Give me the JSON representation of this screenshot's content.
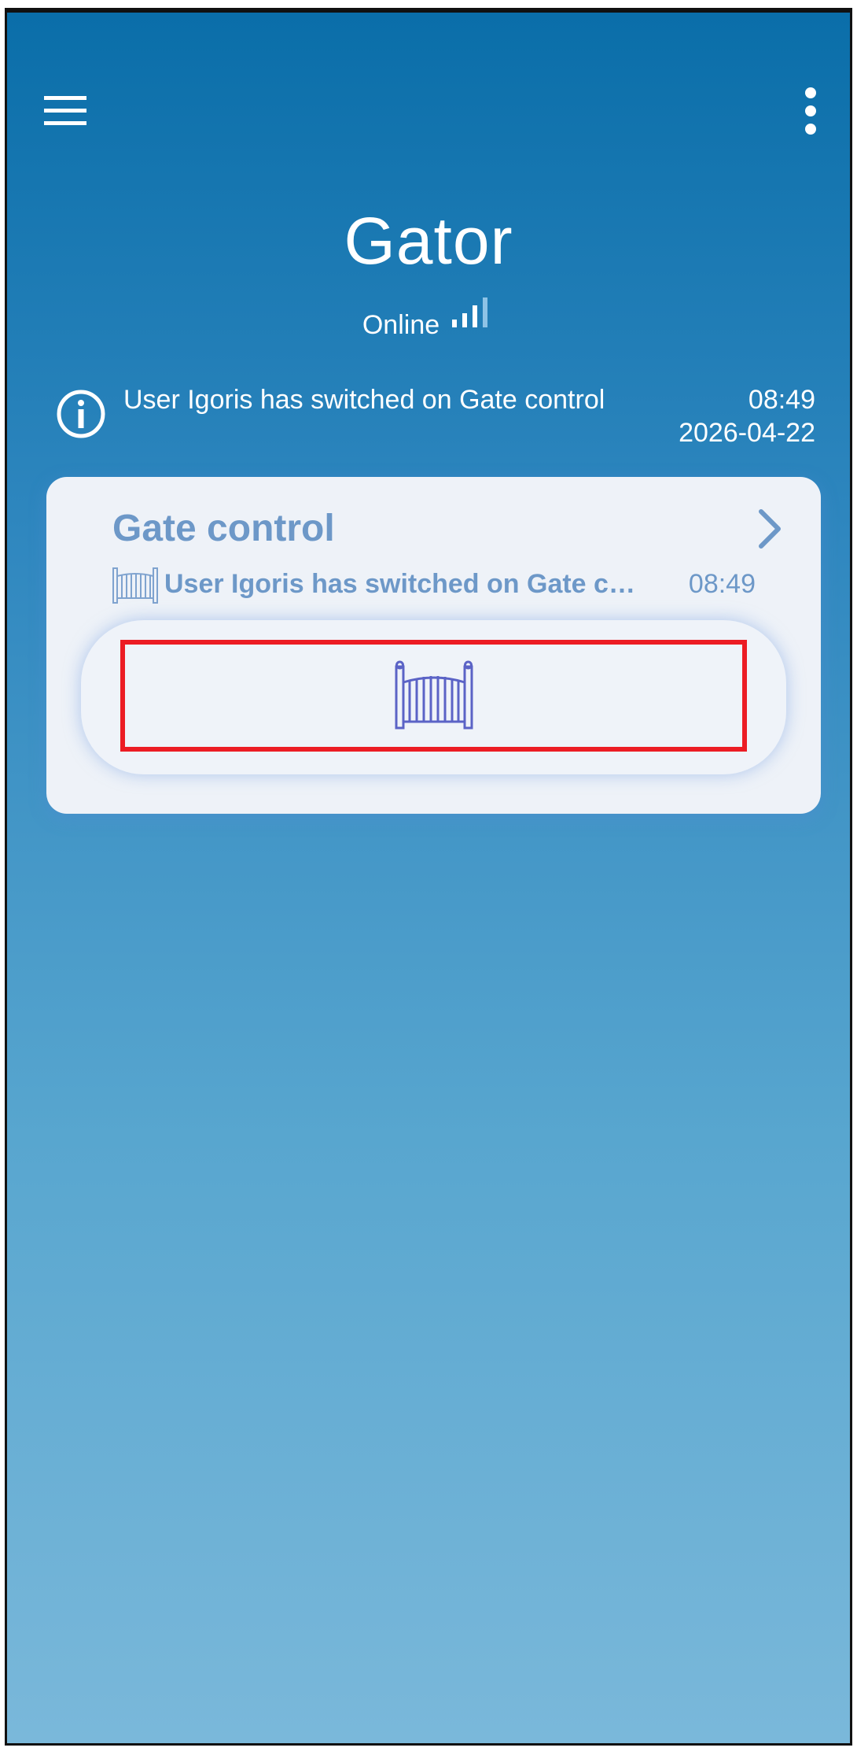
{
  "app": {
    "title": "Gator",
    "status": "Online",
    "signal_level": 3,
    "signal_max": 4
  },
  "toolbar": {
    "menu_icon": "hamburger-menu-icon",
    "more_icon": "more-vertical-icon"
  },
  "notification": {
    "icon": "info-icon",
    "message": "User Igoris has switched on Gate control",
    "time": "08:49",
    "date": "2026-04-22"
  },
  "device_card": {
    "title": "Gate control",
    "chevron_icon": "chevron-right-icon",
    "last_event_icon": "gate-icon",
    "last_event": "User Igoris has switched on Gate control",
    "last_event_time": "08:49",
    "action_icon": "gate-icon"
  },
  "colors": {
    "background_top": "#0a6ea9",
    "background_bottom": "#7ab8da",
    "card_background": "#eef2f8",
    "card_text": "#6d98c8",
    "gate_icon": "#5b63c6",
    "highlight": "#ec1c24"
  }
}
